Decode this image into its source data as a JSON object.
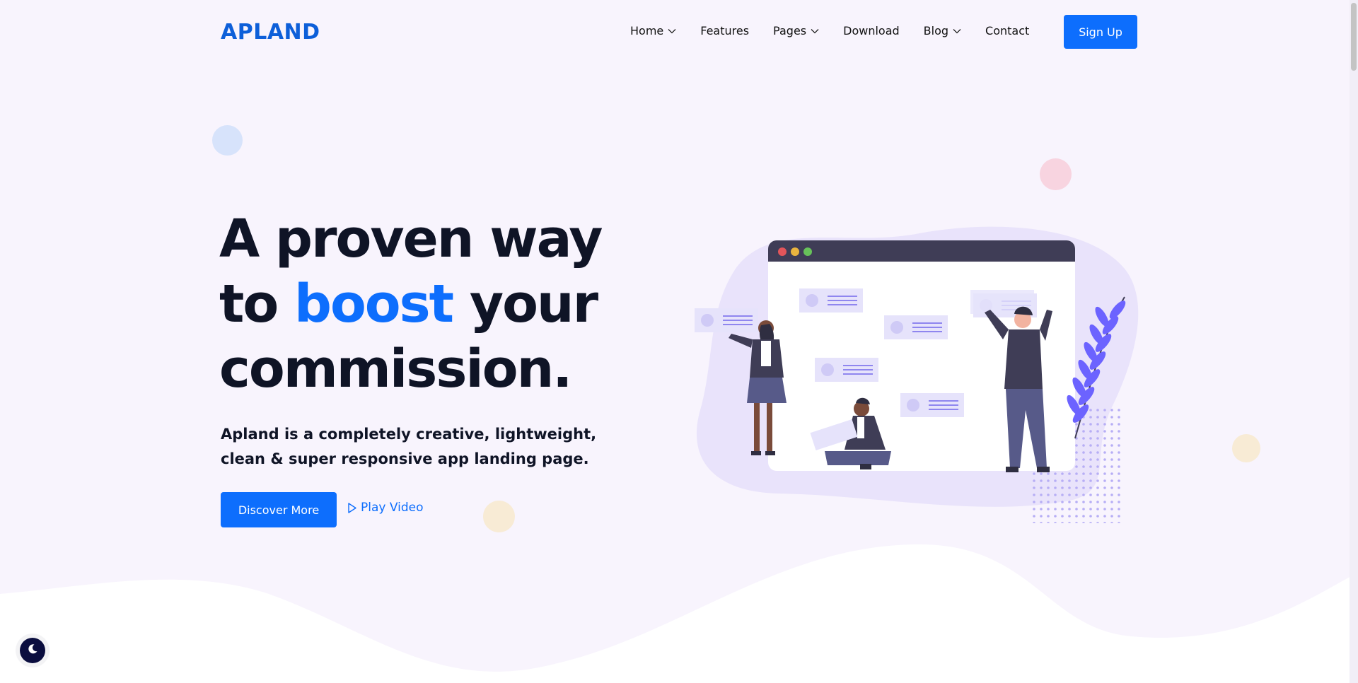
{
  "brand": {
    "logo_text": "APLAND",
    "color": "#0d5fd9"
  },
  "nav": {
    "items": [
      {
        "label": "Home",
        "has_dropdown": true
      },
      {
        "label": "Features",
        "has_dropdown": false
      },
      {
        "label": "Pages",
        "has_dropdown": true
      },
      {
        "label": "Download",
        "has_dropdown": false
      },
      {
        "label": "Blog",
        "has_dropdown": true
      },
      {
        "label": "Contact",
        "has_dropdown": false
      }
    ],
    "signup_label": "Sign Up"
  },
  "hero": {
    "headline_line1": "A proven way",
    "headline_line2_prefix": "to ",
    "headline_line2_accent": "boost",
    "headline_line2_suffix": " your",
    "headline_line3": "commission.",
    "subtitle": "Apland is a completely creative, lightweight, clean & super responsive app landing page.",
    "primary_button": "Discover More",
    "secondary_link": "Play Video"
  },
  "colors": {
    "accent": "#0d6efd",
    "heading": "#0f1426",
    "background": "#f8f4fd",
    "illustration_purple": "#6c63ff",
    "dark_toggle": "#0b0e3f"
  },
  "icons": {
    "chevron": "chevron-down-icon",
    "play": "play-icon",
    "dark_mode": "moon-icon"
  }
}
